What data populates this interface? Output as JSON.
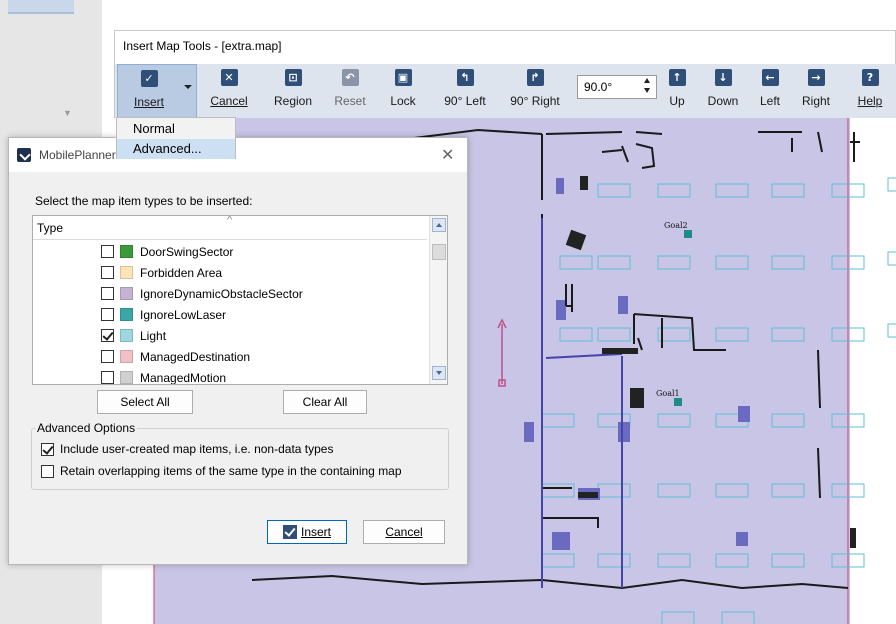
{
  "toolbar_window": {
    "title": "Insert Map Tools - [extra.map]",
    "buttons": [
      {
        "label": "Insert",
        "icon": "check-icon",
        "accel": "I"
      },
      {
        "label": "Cancel",
        "icon": "close-icon",
        "accel": "C"
      },
      {
        "label": "Region",
        "icon": "region-icon"
      },
      {
        "label": "Reset",
        "icon": "reset-icon",
        "disabled": true
      },
      {
        "label": "Lock",
        "icon": "lock-icon",
        "accel": "k"
      },
      {
        "label": "90° Left",
        "icon": "rotate-left-icon"
      },
      {
        "label": "90° Right",
        "icon": "rotate-right-icon"
      },
      {
        "label": "Up",
        "icon": "arrow-up-icon"
      },
      {
        "label": "Down",
        "icon": "arrow-down-icon"
      },
      {
        "label": "Left",
        "icon": "arrow-left-icon"
      },
      {
        "label": "Right",
        "icon": "arrow-right-icon"
      },
      {
        "label": "Help",
        "icon": "help-icon",
        "accel": "H"
      }
    ],
    "angle_value": "90.0°"
  },
  "insert_menu": {
    "items": [
      "Normal",
      "Advanced..."
    ],
    "highlighted": "Advanced..."
  },
  "dialog": {
    "title": "MobilePlanner",
    "prompt": "Select the map item types to be inserted:",
    "column_header": "Type",
    "items": [
      {
        "label": "DoorSwingSector",
        "checked": false,
        "color": "#3a9a3a"
      },
      {
        "label": "Forbidden Area",
        "checked": false,
        "color": "#fde4b8"
      },
      {
        "label": "IgnoreDynamicObstacleSector",
        "checked": false,
        "color": "#c5b3d3"
      },
      {
        "label": "IgnoreLowLaser",
        "checked": false,
        "color": "#3aa6a8"
      },
      {
        "label": "Light",
        "checked": true,
        "color": "#9dd7e0"
      },
      {
        "label": "ManagedDestination",
        "checked": false,
        "color": "#f3c0c8"
      },
      {
        "label": "ManagedMotion",
        "checked": false,
        "color": "#d0d0d0"
      }
    ],
    "select_all_label": "Select All",
    "clear_all_label": "Clear All",
    "advanced_options_title": "Advanced Options",
    "options": [
      {
        "label": "Include user-created map items, i.e. non-data types",
        "checked": true
      },
      {
        "label": "Retain overlapping items of the same type in the containing map",
        "checked": false
      }
    ],
    "insert_label": "Insert",
    "cancel_label": "Cancel"
  },
  "map": {
    "labels": [
      "Goal2",
      "Goal1"
    ],
    "colors": {
      "region_fill": "#c9c5e6",
      "light_item": "#79c8dc",
      "sector": "#5b5bb5",
      "walls": "#1a1a1a"
    }
  }
}
